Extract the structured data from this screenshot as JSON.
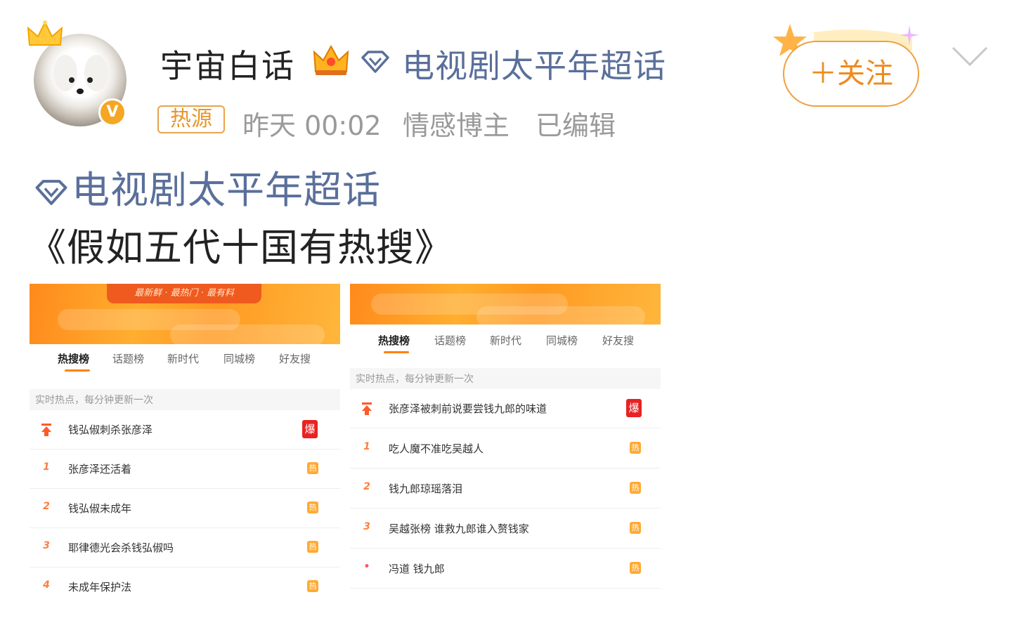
{
  "post": {
    "username": "宇宙白话",
    "supertopic": "电视剧太平年超话",
    "tag": "热源",
    "time": "昨天 00:02",
    "role": "情感博主",
    "edited": "已编辑",
    "follow_label": "＋关注",
    "topic_line": "电视剧太平年超话",
    "title": "《假如五代十国有热搜》"
  },
  "icons": {
    "avatar": "avatar-dog",
    "verified": "verified-v-icon",
    "crown": "crown-icon",
    "diamond": "supertopic-diamond-icon",
    "chevron": "chevron-down-icon"
  },
  "colors": {
    "link": "#5a6f9a",
    "accent_orange": "#f08a1c",
    "hot_red": "#e82222",
    "hot_orange": "#ffaa33"
  },
  "panels": [
    {
      "slogan": "最新鲜 · 最热门 · 最有料",
      "tabs": [
        "热搜榜",
        "话题榜",
        "新时代",
        "同城榜",
        "好友搜"
      ],
      "subheader": "实时热点，每分钟更新一次",
      "rows": [
        {
          "rank": "",
          "text": "钱弘俶刺杀张彦泽",
          "badge": "爆"
        },
        {
          "rank": "1",
          "text": "张彦泽还活着",
          "badge": "热"
        },
        {
          "rank": "2",
          "text": "钱弘俶未成年",
          "badge": "热"
        },
        {
          "rank": "3",
          "text": "耶律德光会杀钱弘俶吗",
          "badge": "热"
        },
        {
          "rank": "4",
          "text": "未成年保护法",
          "badge": "热"
        }
      ]
    },
    {
      "tabs": [
        "热搜榜",
        "话题榜",
        "新时代",
        "同城榜",
        "好友搜"
      ],
      "subheader": "实时热点，每分钟更新一次",
      "rows": [
        {
          "rank": "",
          "text": "张彦泽被刺前说要尝钱九郎的味道",
          "badge": "爆"
        },
        {
          "rank": "1",
          "text": "吃人魔不准吃吴越人",
          "badge": "热"
        },
        {
          "rank": "2",
          "text": "钱九郎琼瑶落泪",
          "badge": "热"
        },
        {
          "rank": "3",
          "text": "吴越张榜 谁救九郎谁入赘钱家",
          "badge": "热"
        },
        {
          "rank": "•",
          "text": "冯道 钱九郎",
          "badge": "热"
        }
      ]
    }
  ]
}
